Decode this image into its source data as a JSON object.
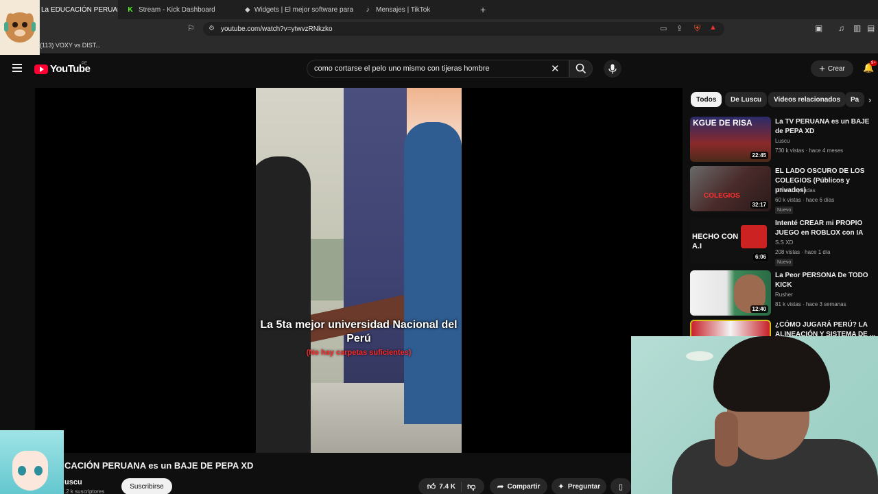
{
  "browser": {
    "tabs": [
      {
        "label": "La EDUCACIÓN PERUAN",
        "active": true
      },
      {
        "label": "Stream - Kick Dashboard"
      },
      {
        "label": "Widgets | El mejor software para pot"
      },
      {
        "label": "Mensajes | TikTok"
      }
    ],
    "new_tab": "+",
    "url": "youtube.com/watch?v=ytwvzRNkzko",
    "bookmark": "(113) VOXY vs DIST..."
  },
  "youtube": {
    "logo_text": "YouTube",
    "region": "PE",
    "search_query": "como cortarse el pelo uno mismo con tijeras hombre",
    "create_label": "Crear",
    "notif_count": "9+"
  },
  "video": {
    "caption_main": "La 5ta mejor universidad Nacional del Perú",
    "caption_sub": "(No hay carpetas suficientes)",
    "title": "CACIÓN PERUANA es un BAJE DE PEPA XD",
    "channel": "uscu",
    "subscribers": ".2 k suscriptores",
    "subscribe_label": "Suscribirse",
    "likes": "7.4 K",
    "share_label": "Compartir",
    "ask_label": "Preguntar"
  },
  "sidebar": {
    "chips": [
      "Todos",
      "De Luscu",
      "Videos relacionados",
      "Pa"
    ],
    "videos": [
      {
        "title": "La TV PERUANA es un BAJE de PEPA XD",
        "channel": "Luscu",
        "meta": "730 k vistas · hace 4 meses",
        "duration": "22:45",
        "thumb_text": "KGUE DE RISA",
        "is_new": false,
        "thumb_color": "#7a2020"
      },
      {
        "title": "EL LADO OSCURO DE LOS COLEGIOS (Públicos y privados)",
        "channel": "Mister Leyendas",
        "meta": "60 k vistas · hace 6 días",
        "duration": "32:17",
        "thumb_text": "COLEGIOS",
        "is_new": true,
        "new_label": "Nuevo",
        "thumb_color": "#5a3a3a"
      },
      {
        "title": "Intenté CREAR mi PROPIO JUEGO en ROBLOX con IA",
        "channel": "S.S XD",
        "meta": "208 vistas · hace 1 día",
        "duration": "6:06",
        "thumb_text": "HECHO CON A.I",
        "is_new": true,
        "new_label": "Nuevo",
        "thumb_color": "#111111"
      },
      {
        "title": "La Peor PERSONA De TODO KICK",
        "channel": "Rusher",
        "meta": "81 k vistas · hace 3 semanas",
        "duration": "12:40",
        "thumb_text": "",
        "is_new": false,
        "thumb_color": "#3e8a5a"
      },
      {
        "title": "¿CÓMO JUGARÁ PERÚ? LA ALINEACIÓN Y SISTEMA DE ...",
        "channel": "",
        "meta": "",
        "duration": "",
        "thumb_text": "",
        "is_new": false,
        "thumb_color": "#b02a2a"
      }
    ]
  },
  "colors": {
    "accent": "#ff0033",
    "background": "#0f0f0f",
    "chip": "#272727"
  }
}
